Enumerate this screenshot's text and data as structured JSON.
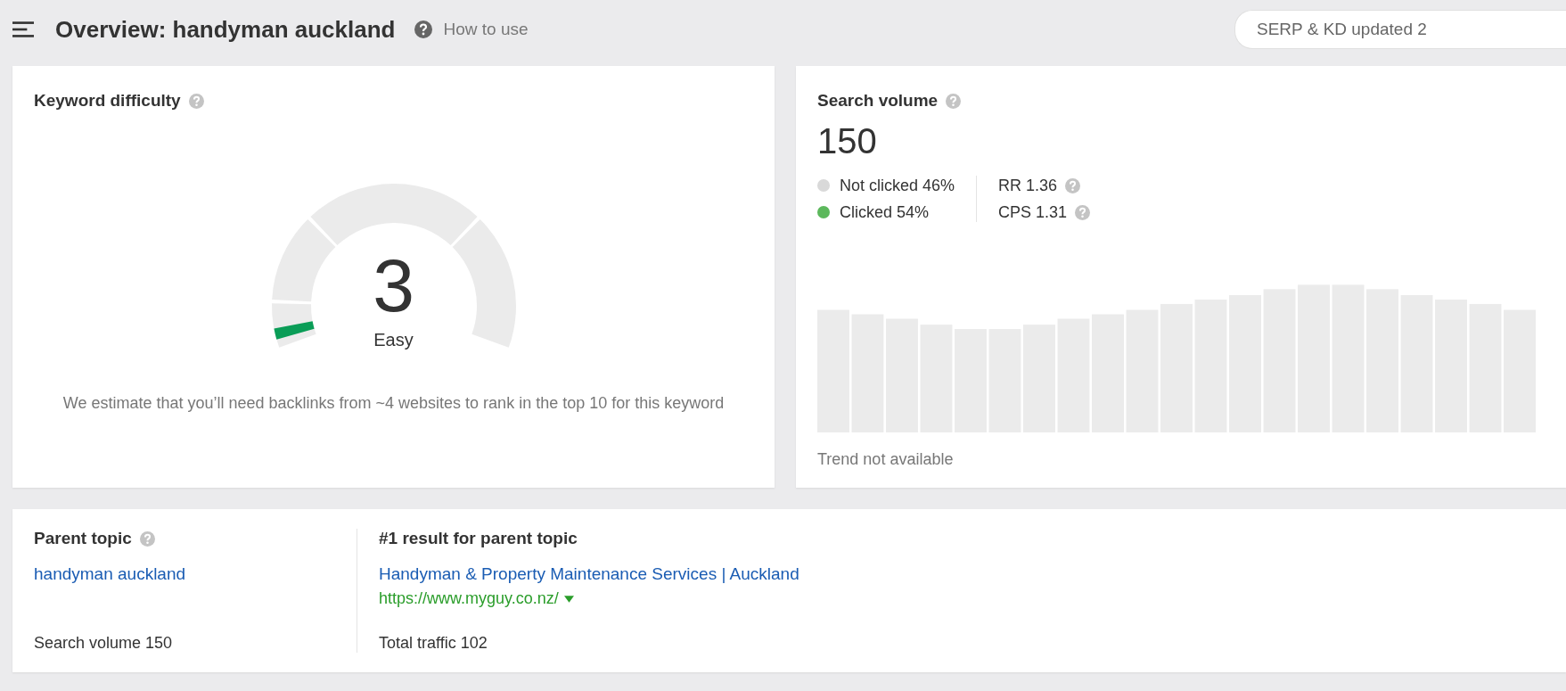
{
  "header": {
    "title": "Overview: handyman auckland",
    "help_link": "How to use",
    "update_badge": "SERP & KD updated 2"
  },
  "keyword_difficulty": {
    "title": "Keyword difficulty",
    "score": "3",
    "level": 0.03,
    "rating": "Easy",
    "description": "We estimate that you’ll need backlinks from ~4 websites to rank in the top 10 for this keyword"
  },
  "search_volume": {
    "title": "Search volume",
    "value": "150",
    "clicks": [
      {
        "label": "Not clicked 46%",
        "color": "#d9d9d9"
      },
      {
        "label": "Clicked 54%",
        "color": "#5cb85c"
      }
    ],
    "metrics": [
      "RR 1.36",
      "CPS 1.31"
    ],
    "trend_note": "Trend not available"
  },
  "parent_topic": {
    "title": "Parent topic",
    "topic_link": "handyman auckland",
    "search_volume": "Search volume 150",
    "result_heading": "#1 result for parent topic",
    "result_title": "Handyman & Property Maintenance Services | Auckland",
    "result_url": "https://www.myguy.co.nz/",
    "total_traffic": "Total traffic 102"
  }
}
